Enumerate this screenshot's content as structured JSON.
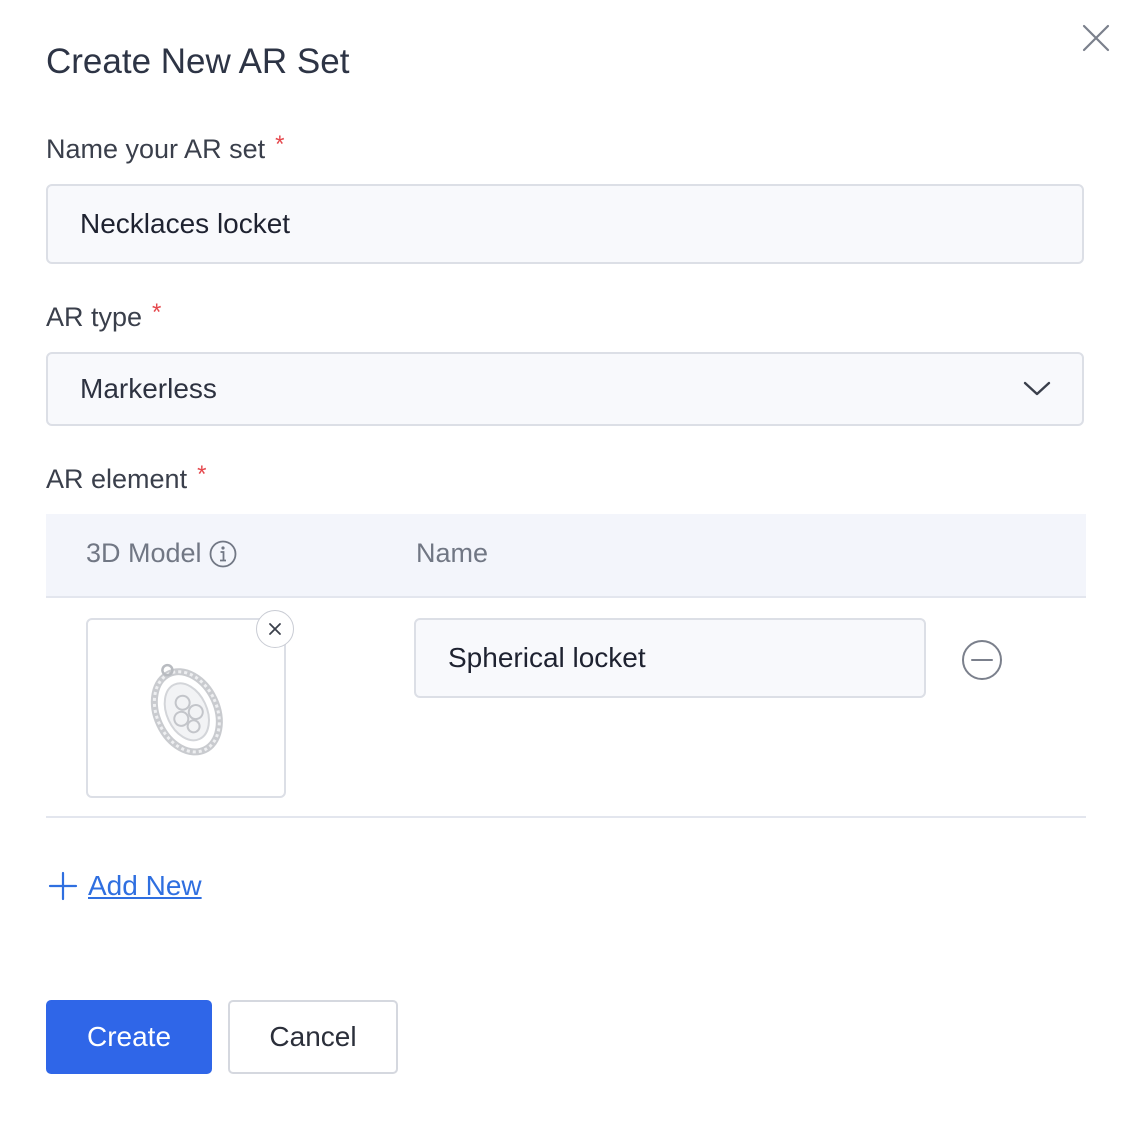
{
  "dialog": {
    "title": "Create New AR Set"
  },
  "form": {
    "name_label": "Name your AR set",
    "name_value": "Necklaces locket",
    "type_label": "AR type",
    "type_value": "Markerless",
    "element_label": "AR element",
    "required_marker": "*"
  },
  "table": {
    "col_model": "3D Model",
    "col_name": "Name",
    "rows": [
      {
        "name": "Spherical locket"
      }
    ]
  },
  "actions": {
    "add_new": "Add New",
    "create": "Create",
    "cancel": "Cancel"
  },
  "icons": {
    "close": "close-icon",
    "info": "info-icon",
    "chevron": "chevron-down-icon",
    "thumb_remove": "close-icon",
    "row_remove": "minus-circle-icon",
    "add": "plus-icon"
  },
  "colors": {
    "primary": "#2f66e8",
    "link": "#2f6fe0",
    "required": "#e5484d"
  }
}
